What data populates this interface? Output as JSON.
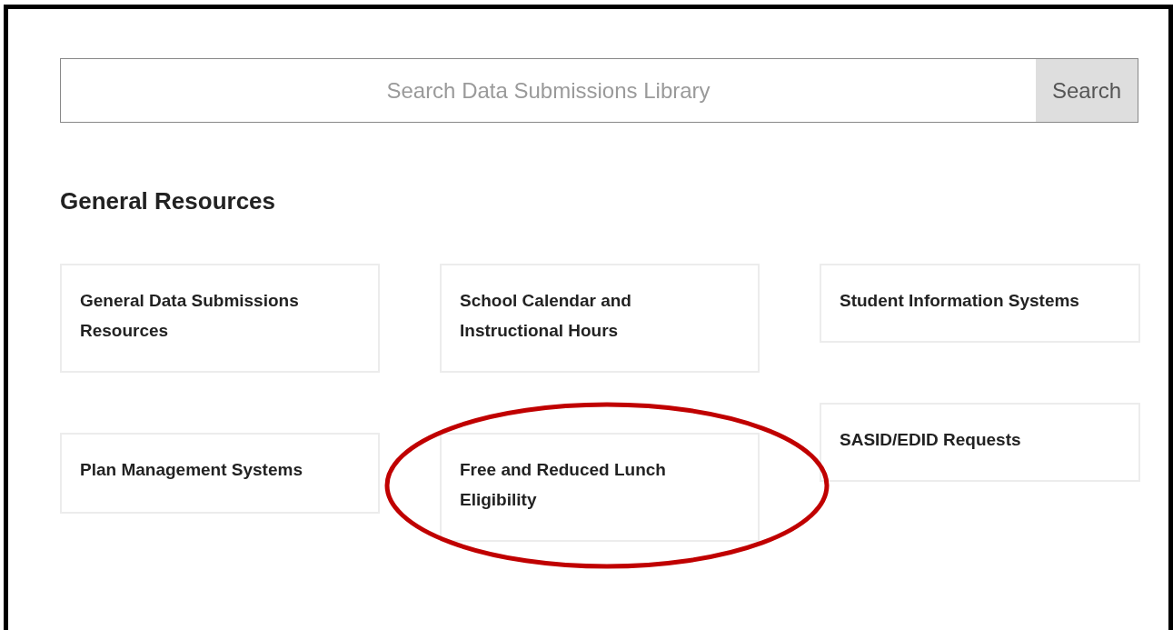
{
  "search": {
    "placeholder": "Search Data Submissions Library",
    "button": "Search"
  },
  "section_title": "General Resources",
  "columns": [
    [
      {
        "title": "General Data Submissions Resources",
        "circled": false
      },
      {
        "title": "Plan Management Systems",
        "circled": false
      }
    ],
    [
      {
        "title": "School Calendar and Instructional Hours",
        "circled": false
      },
      {
        "title": "Free and Reduced Lunch Eligibility",
        "circled": true
      }
    ],
    [
      {
        "title": "Student Information Systems",
        "circled": false
      },
      {
        "title": "SASID/EDID Requests",
        "circled": false
      }
    ]
  ]
}
